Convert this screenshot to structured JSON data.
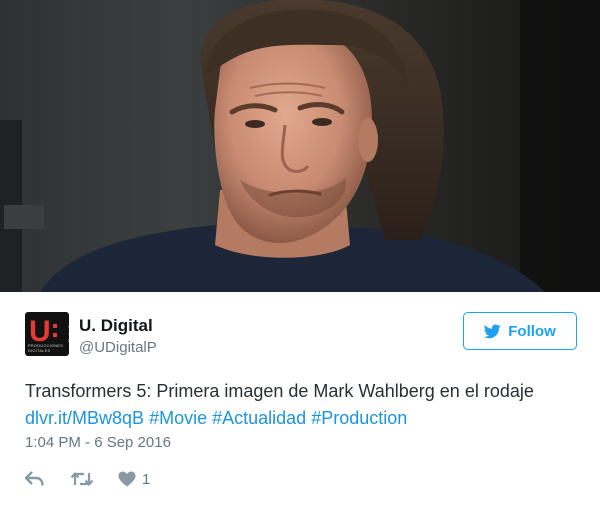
{
  "colors": {
    "brand_blue": "#1da1f2",
    "link_blue": "#1b95e0",
    "avatar_red": "#e53935",
    "muted_gray": "#657786"
  },
  "media": {
    "icon": "photo"
  },
  "author": {
    "avatar_letter": "U",
    "avatar_small_text": "PRODUCCIONES DIGITALES",
    "avatar_side_text": "digital",
    "display_name": "U. Digital",
    "handle": "@UDigitalP"
  },
  "follow_button": {
    "label": "Follow",
    "icon": "twitter-bird-icon"
  },
  "tweet": {
    "text": "Transformers 5: Primera imagen de Mark Wahlberg en el rodaje",
    "link": "dlvr.it/MBw8qB",
    "hashtags": [
      "#Movie",
      "#Actualidad",
      "#Production"
    ],
    "timestamp": "1:04 PM - 6 Sep 2016"
  },
  "actions": {
    "reply_icon": "reply-icon",
    "retweet_icon": "retweet-icon",
    "like_icon": "heart-icon",
    "like_count": "1"
  }
}
